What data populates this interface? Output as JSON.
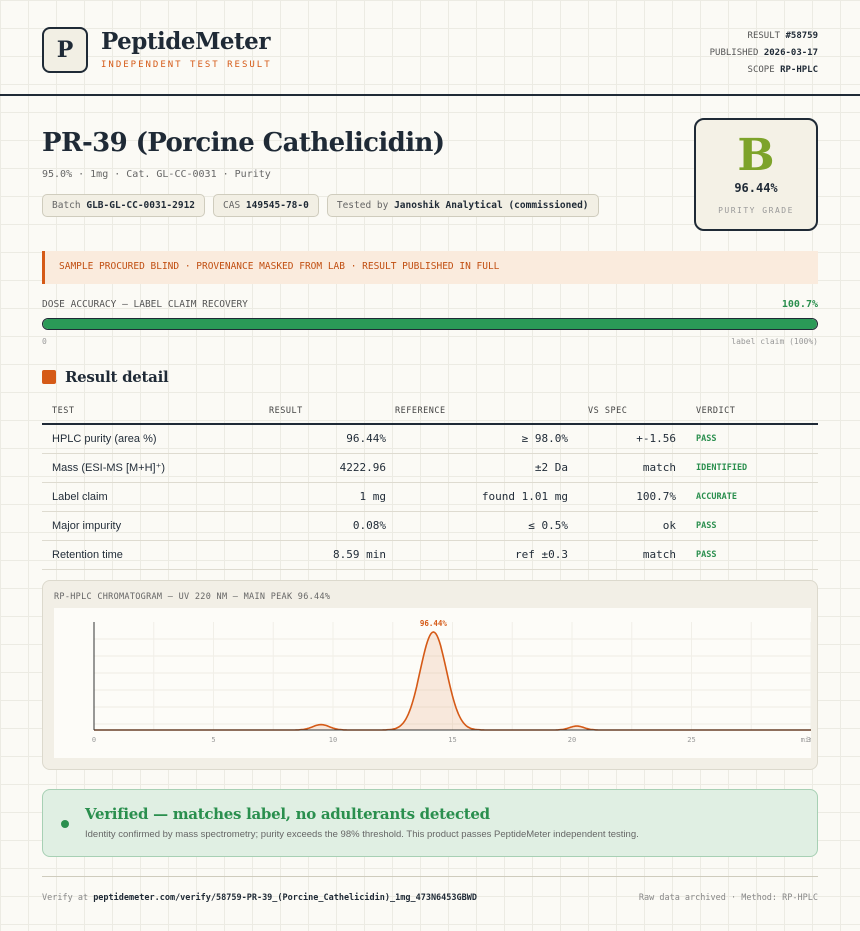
{
  "header": {
    "logo_letter": "P",
    "brand": "PeptideMeter",
    "brand_sub": "INDEPENDENT TEST RESULT",
    "result_label": "RESULT",
    "result_value": "#58759",
    "published_label": "PUBLISHED",
    "published_value": "2026-03-17",
    "scope_label": "SCOPE",
    "scope_value": "RP-HPLC"
  },
  "product": {
    "title": "PR-39 (Porcine Cathelicidin)",
    "subtitle": "95.0% · 1mg · Cat. GL-CC-0031 · Purity",
    "batch_label": "Batch",
    "batch_value": "GLB-GL-CC-0031-2912",
    "cas_label": "CAS",
    "cas_value": "149545-78-0",
    "tested_label": "Tested by",
    "tested_value": "Janoshik Analytical (commissioned)"
  },
  "grade": {
    "letter": "B",
    "percent": "96.44%",
    "label": "PURITY GRADE",
    "color": "#7da32a"
  },
  "notice": "SAMPLE PROCURED BLIND · PROVENANCE MASKED FROM LAB · RESULT PUBLISHED IN FULL",
  "dose": {
    "label": "DOSE ACCURACY — LABEL CLAIM RECOVERY",
    "value": "100.7%",
    "fill_fraction": 1.0,
    "min_label": "0",
    "max_label": "label claim (100%)"
  },
  "section_title": "Result detail",
  "table": {
    "headers": [
      "TEST",
      "RESULT",
      "REFERENCE",
      "VS SPEC",
      "VERDICT"
    ],
    "rows": [
      {
        "test": "HPLC purity (area %)",
        "result": "96.44%",
        "reference": "≥ 98.0%",
        "vs": "+-1.56",
        "verdict": "PASS"
      },
      {
        "test": "Mass (ESI-MS [M+H]⁺)",
        "result": "4222.96",
        "reference": "±2 Da",
        "vs": "match",
        "verdict": "IDENTIFIED"
      },
      {
        "test": "Label claim",
        "result": "1 mg",
        "reference": "found 1.01 mg",
        "vs": "100.7%",
        "verdict": "ACCURATE"
      },
      {
        "test": "Major impurity",
        "result": "0.08%",
        "reference": "≤ 0.5%",
        "vs": "ok",
        "verdict": "PASS"
      },
      {
        "test": "Retention time",
        "result": "8.59 min",
        "reference": "ref ±0.3",
        "vs": "match",
        "verdict": "PASS"
      }
    ]
  },
  "chart_data": {
    "type": "line",
    "title": "RP-HPLC CHROMATOGRAM — UV 220 NM — MAIN PEAK 96.44%",
    "xlabel": "",
    "ylabel": "",
    "xlim": [
      0,
      30
    ],
    "x_ticks": [
      "0",
      "5",
      "10",
      "15",
      "20",
      "25",
      "30"
    ],
    "x_unit": "min",
    "peaks": [
      {
        "x": 9.5,
        "height": 0.055,
        "width": 0.35
      },
      {
        "x": 14.2,
        "height": 1.0,
        "width": 0.55,
        "label": "96.44%"
      },
      {
        "x": 20.2,
        "height": 0.04,
        "width": 0.3
      }
    ],
    "baseline": 0.0,
    "line_color": "#d55a17"
  },
  "verified": {
    "title": "Verified — matches label, no adulterants detected",
    "text": "Identity confirmed by mass spectrometry; purity exceeds the 98% threshold. This product passes PeptideMeter independent testing."
  },
  "footer": {
    "verify_label": "Verify at",
    "verify_url": "peptidemeter.com/verify/58759-PR-39_(Porcine_Cathelicidin)_1mg_473N6453GBWD",
    "right": "Raw data archived · Method: RP-HPLC"
  }
}
